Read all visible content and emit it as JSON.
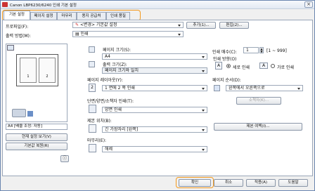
{
  "window": {
    "title": "Canon LBP6230/6240 인쇄 기본 설정"
  },
  "tabs": [
    "기본 설정",
    "페이지 설정",
    "마무리",
    "용지 공급처",
    "인쇄 품질"
  ],
  "profile": {
    "label": "프로파일(F):",
    "value": "<변경> 기본값 설정",
    "add_btn": "추가(1)...",
    "edit_btn": "편집(2)..."
  },
  "output": {
    "label": "출력 방법(M):",
    "value": "인쇄"
  },
  "preview": {
    "caption": "A4 [배율 조정: 자동]",
    "view_btn": "현재 설정 보기(V)",
    "restore_btn": "기본값 복원(R)"
  },
  "page_size": {
    "label": "페이지 크기(S):",
    "value": "A4"
  },
  "output_size": {
    "label": "출력 크기(Z):",
    "value": "페이지 크기와 일치"
  },
  "copies": {
    "label": "인쇄 매수(C):",
    "value": "1",
    "range": "[1 ~ 999]"
  },
  "orientation": {
    "label": "인쇄 방향(O)",
    "portrait": "세로 인쇄",
    "landscape": "가로 인쇄",
    "selected": "portrait"
  },
  "layout": {
    "label": "페이지 레이아웃(Y):",
    "value": "1 면에 2 쪽 인쇄",
    "badge": "2"
  },
  "page_order": {
    "label": "페이지 순서(D):",
    "value": "왼쪽에서 오른쪽으로",
    "unit_btn": "소책자(K)..."
  },
  "duplex": {
    "label": "단면/양면/소책자 인쇄(T):",
    "value": "양면 인쇄"
  },
  "binding": {
    "label": "제본 위치(B):",
    "value": "긴 가장자리 [왼쪽]",
    "margin_btn": "제본 여백(I)..."
  },
  "finishing": {
    "label": "마무리(E):",
    "value": "해제"
  },
  "footer": {
    "ok": "확인",
    "cancel": "취소",
    "apply": "적용(A)",
    "help": "도움말"
  }
}
